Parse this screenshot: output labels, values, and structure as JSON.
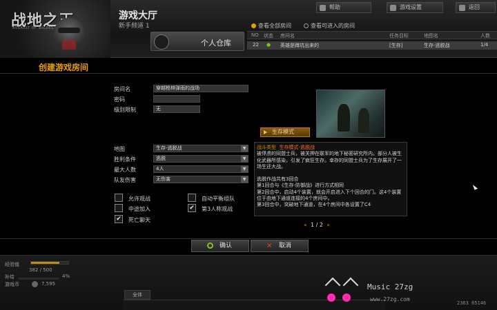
{
  "header": {
    "logo_text": "战地之王",
    "logo_sub": "ASSAULT OF WILDEST ARMS",
    "hall_title": "游戏大厅",
    "channel": "新手频道 1",
    "locker_label": "个人仓库",
    "buttons": {
      "help": "帮助",
      "settings": "游戏设置",
      "back": "返回"
    },
    "radios": {
      "all_rooms": "查看全部房间",
      "enterable_rooms": "查看可进入的房间",
      "selected": "all_rooms"
    }
  },
  "room_list": {
    "columns": [
      "NO",
      "状态",
      "房间名",
      "任务目标",
      "地图名",
      "人数"
    ],
    "rows": [
      {
        "no": "22",
        "status": "●",
        "name": "英雄是蹲坑出来的",
        "mission": "[生存]",
        "map": "生存-逃脱战",
        "players": "1/4"
      }
    ]
  },
  "modal": {
    "title": "创建游戏房间",
    "room_name_label": "房间名",
    "room_name_value": "穿越枪林弹雨的战场",
    "password_label": "密码",
    "password_value": "",
    "level_label": "级别限制",
    "level_value": "无",
    "mode_tab": "生存模式",
    "map_label": "地图",
    "map_value": "生存-逃脱战",
    "win_label": "胜利条件",
    "win_value": "逃脱",
    "max_label": "最大人数",
    "max_value": "4人",
    "ff_label": "队友伤害",
    "ff_value": "无伤害",
    "checkboxes": {
      "allow_spectate": {
        "label": "允许观战",
        "checked": false
      },
      "auto_balance": {
        "label": "自动平衡组队",
        "checked": false
      },
      "mid_join": {
        "label": "中途加入",
        "checked": false
      },
      "third_person": {
        "label": "第3人称观战",
        "checked": true
      },
      "death_chat": {
        "label": "死亡聊天",
        "checked": true
      }
    },
    "description": {
      "type_key": "战斗类型",
      "type_value": "生存模式-逃脱战",
      "lines": [
        "被俘虏的同盟士兵，被关押在联军的地下秘密研究所内。部分人被生化武器所感染，引发了疯狂生存。幸存的同盟士兵为了生存展开了一场生还大战。",
        "",
        "逃脱作战共有3回合",
        "第1回合与《生存-防御战》进行方式相同",
        "第2回合中，启动4个装置，就会开启进入下个回合的门。这4个装置位于由地下通道连接的4个房间中。",
        "第3回合中，突破地下通道，在4个房间中各设置了C4"
      ]
    },
    "pager": {
      "current": "1",
      "total": "2",
      "left_arrow": "«",
      "right_arrow": "»"
    },
    "ok_label": "确认",
    "cancel_label": "取消"
  },
  "footer": {
    "exp_label": "经验值",
    "exp_text": "382 / 500",
    "exp_fraction": 0.764,
    "supply_label": "补给",
    "supply_text": "4%",
    "coin_label": "游戏币",
    "coin_text": "7,595",
    "chat_tab": "全体",
    "watermark_music": "Music 27zg",
    "watermark_url": "www.27zg.com",
    "status_number": "2363 65146"
  }
}
